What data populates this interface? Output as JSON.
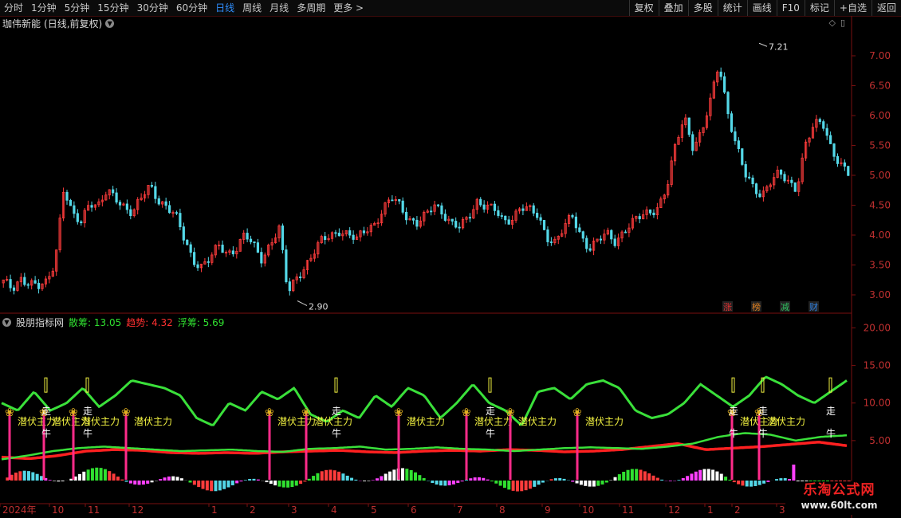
{
  "toolbar": {
    "timeframes": [
      "分时",
      "1分钟",
      "5分钟",
      "15分钟",
      "30分钟",
      "60分钟",
      "日线",
      "周线",
      "月线",
      "多周期",
      "更多"
    ],
    "active": "日线",
    "buttons": [
      "复权",
      "叠加",
      "多股",
      "统计",
      "画线",
      "F10",
      "标记",
      "+自选",
      "返回"
    ]
  },
  "main_chart": {
    "stock_name": "珈伟新能",
    "mode": "(日线,前复权)",
    "y_ticks": [
      "7.00",
      "6.50",
      "6.00",
      "5.50",
      "5.00",
      "4.50",
      "4.00",
      "3.50",
      "3.00"
    ],
    "high_label": "7.21",
    "low_label": "2.90",
    "markers": [
      {
        "text": "涨",
        "color": "#e03030"
      },
      {
        "text": "榜",
        "color": "#e08020"
      },
      {
        "text": "减",
        "color": "#30c060"
      },
      {
        "text": "财",
        "color": "#3080e0"
      }
    ]
  },
  "indicator": {
    "name": "股朋指标网",
    "values": [
      {
        "label": "散筹: 13.05",
        "color": "#30e030"
      },
      {
        "label": "趋势: 4.32",
        "color": "#ff3030"
      },
      {
        "label": "浮筹: 5.69",
        "color": "#30e030"
      }
    ],
    "y_ticks": [
      "20.00",
      "15.00",
      "10.00",
      "5.00"
    ],
    "signal_label": "潜伏主力",
    "walk_label": "走",
    "bull_label": "牛"
  },
  "x_axis": {
    "labels": [
      "2024年",
      "10",
      "11",
      "12",
      "1",
      "2",
      "3",
      "4",
      "5",
      "6",
      "7",
      "8",
      "9",
      "10",
      "11",
      "12",
      "1",
      "2",
      "3",
      "4"
    ]
  },
  "watermark": {
    "line1": "乐淘公式网",
    "line2": "www.60lt.com"
  },
  "colors": {
    "up": "#ff3c3c",
    "down": "#54d8e8",
    "axis": "#7a1010",
    "green_line": "#3ae03a",
    "red_line": "#ff2020",
    "signal_bar": "#ff2b8a"
  },
  "chart_data": [
    {
      "type": "candlestick",
      "title": "珈伟新能(日线,前复权)",
      "x_labels": [
        "2024年",
        "10",
        "11",
        "12",
        "1",
        "2",
        "3",
        "4",
        "5",
        "6",
        "7",
        "8",
        "9",
        "10",
        "11",
        "12",
        "1",
        "2",
        "3",
        "4"
      ],
      "ylim": [
        2.8,
        7.4
      ],
      "close_series": [
        3.2,
        3.1,
        3.3,
        3.2,
        3.1,
        3.2,
        3.6,
        4.8,
        4.3,
        4.2,
        4.6,
        4.5,
        4.7,
        4.6,
        4.5,
        4.4,
        4.6,
        4.8,
        4.6,
        4.5,
        4.3,
        3.9,
        3.6,
        3.5,
        3.6,
        3.8,
        3.7,
        3.8,
        4.0,
        3.8,
        3.6,
        3.9,
        4.1,
        3.0,
        3.3,
        3.5,
        3.7,
        3.9,
        4.0,
        4.1,
        4.0,
        3.9,
        4.1,
        4.2,
        4.4,
        4.6,
        4.5,
        4.3,
        4.2,
        4.3,
        4.5,
        4.4,
        4.2,
        4.1,
        4.3,
        4.6,
        4.5,
        4.4,
        4.2,
        4.3,
        4.5,
        4.4,
        4.3,
        4.0,
        3.9,
        4.1,
        4.3,
        4.0,
        3.8,
        3.9,
        4.0,
        3.9,
        4.1,
        4.2,
        4.3,
        4.4,
        4.5,
        4.8,
        5.5,
        6.0,
        5.5,
        5.7,
        6.2,
        6.9,
        6.1,
        5.5,
        5.0,
        4.8,
        4.7,
        4.9,
        5.0,
        4.9,
        4.8,
        5.5,
        5.8,
        5.9,
        5.5,
        5.2,
        5.0
      ],
      "high": 7.21,
      "low": 2.9
    },
    {
      "type": "line",
      "title": "股朋指标网",
      "ylim": [
        0,
        21
      ],
      "series": [
        {
          "name": "散筹",
          "values": [
            10.0,
            9.0,
            11.5,
            9.0,
            10.0,
            12.0,
            9.5,
            11.0,
            13.0,
            12.5,
            12.0,
            11.0,
            8.0,
            7.0,
            10.0,
            9.0,
            11.5,
            10.5,
            12.0,
            8.5,
            7.5,
            9.0,
            8.0,
            11.0,
            9.5,
            12.0,
            11.0,
            8.0,
            10.0,
            12.5,
            10.0,
            9.0,
            7.0,
            11.5,
            12.0,
            10.5,
            12.5,
            13.0,
            12.0,
            9.0,
            8.0,
            8.5,
            10.0,
            12.5,
            11.0,
            9.5,
            11.0,
            13.5,
            12.5,
            11.0,
            10.0,
            11.5,
            13.0
          ],
          "color": "#3ae03a"
        },
        {
          "name": "浮筹",
          "values": [
            2.5,
            3.0,
            3.6,
            4.0,
            4.2,
            4.0,
            3.8,
            3.6,
            3.7,
            3.8,
            3.6,
            3.5,
            3.9,
            4.0,
            4.2,
            3.8,
            3.9,
            4.1,
            3.9,
            3.8,
            3.6,
            3.8,
            4.0,
            4.1,
            4.0,
            3.9,
            4.2,
            4.6,
            5.5,
            6.0,
            5.8,
            5.0,
            5.5,
            5.7
          ],
          "color": "#3ae03a"
        },
        {
          "name": "趋势",
          "values": [
            2.8,
            2.6,
            3.0,
            3.6,
            3.8,
            3.7,
            3.4,
            3.3,
            3.4,
            3.3,
            3.5,
            3.6,
            3.7,
            3.5,
            3.4,
            3.6,
            3.7,
            3.6,
            3.8,
            3.7,
            3.5,
            3.6,
            3.8,
            4.2,
            4.6,
            3.8,
            4.0,
            4.2,
            4.5,
            4.8,
            4.32
          ],
          "color": "#ff2020"
        }
      ]
    }
  ]
}
